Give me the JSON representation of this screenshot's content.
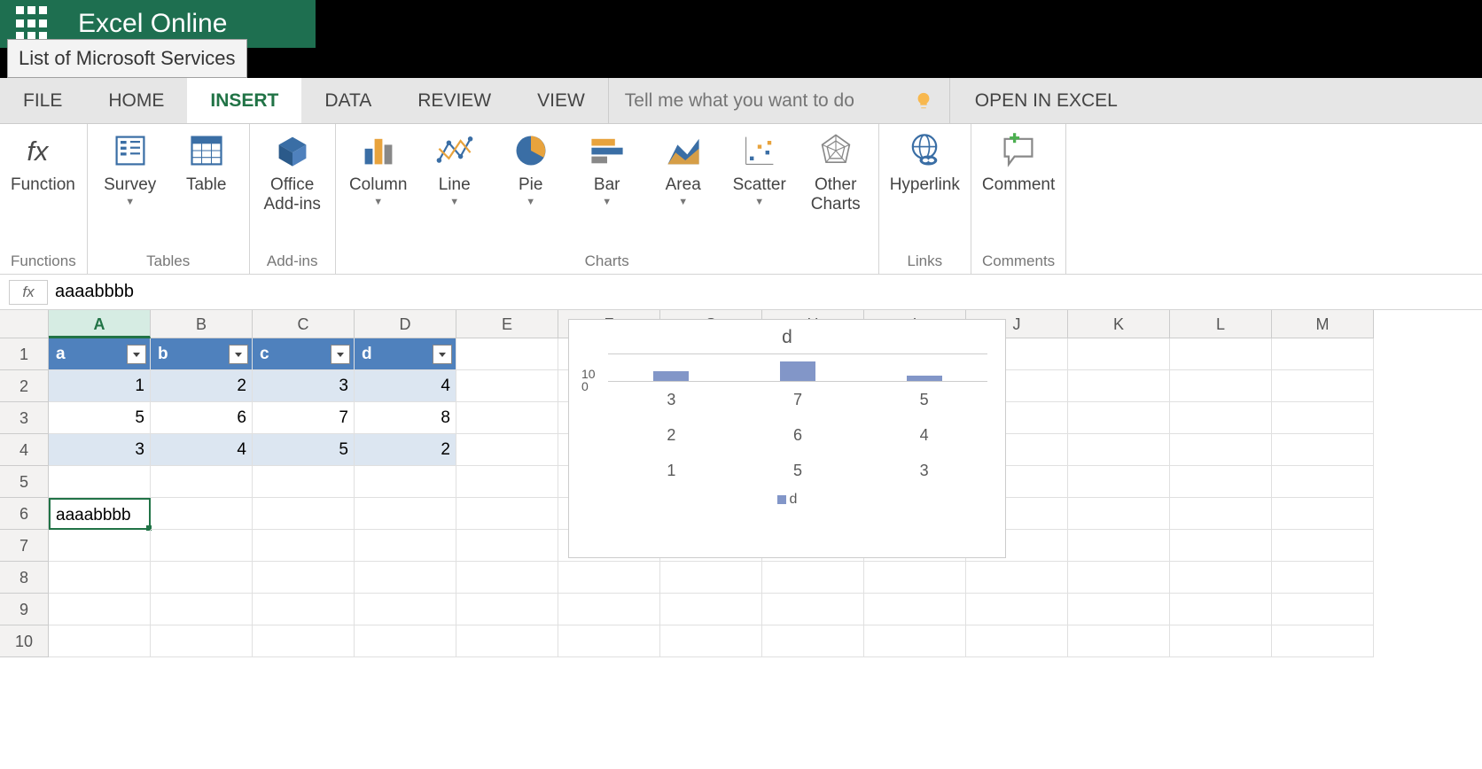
{
  "brand": {
    "title": "Excel Online",
    "tooltip": "List of Microsoft Services"
  },
  "tabs": {
    "file": "FILE",
    "home": "HOME",
    "insert": "INSERT",
    "data": "DATA",
    "review": "REVIEW",
    "view": "VIEW",
    "open_in_excel": "OPEN IN EXCEL"
  },
  "search": {
    "placeholder": "Tell me what you want to do"
  },
  "ribbon": {
    "function": "Function",
    "functions_group": "Functions",
    "survey": "Survey",
    "table": "Table",
    "tables_group": "Tables",
    "addins": "Office\nAdd-ins",
    "addins_group": "Add-ins",
    "column": "Column",
    "line": "Line",
    "pie": "Pie",
    "bar": "Bar",
    "area": "Area",
    "scatter": "Scatter",
    "other": "Other\nCharts",
    "charts_group": "Charts",
    "hyperlink": "Hyperlink",
    "links_group": "Links",
    "comment": "Comment",
    "comments_group": "Comments"
  },
  "formula_bar": {
    "value": "aaaabbbb"
  },
  "columns": [
    "A",
    "B",
    "C",
    "D",
    "E",
    "F",
    "G",
    "H",
    "I",
    "J",
    "K",
    "L",
    "M"
  ],
  "rows": [
    "1",
    "2",
    "3",
    "4",
    "5",
    "6",
    "7",
    "8",
    "9",
    "10"
  ],
  "active_column": "A",
  "table": {
    "headers": [
      "a",
      "b",
      "c",
      "d"
    ],
    "data": [
      [
        1,
        2,
        3,
        4
      ],
      [
        5,
        6,
        7,
        8
      ],
      [
        3,
        4,
        5,
        2
      ]
    ]
  },
  "cell_a6": "aaaabbbb",
  "chart_data": {
    "type": "bar",
    "title": "d",
    "series": [
      {
        "name": "d",
        "values": [
          4,
          8,
          2
        ]
      }
    ],
    "y_ticks": [
      "10",
      "0"
    ],
    "category_grid": [
      [
        "3",
        "7",
        "5"
      ],
      [
        "2",
        "6",
        "4"
      ],
      [
        "1",
        "5",
        "3"
      ]
    ],
    "ylim": [
      0,
      10
    ]
  }
}
